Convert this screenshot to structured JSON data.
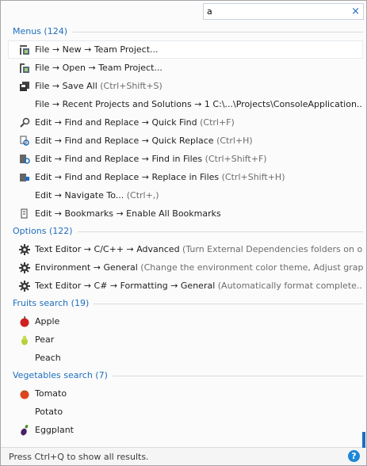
{
  "search": {
    "value": "a"
  },
  "clear_glyph": "×",
  "categories": [
    {
      "label": "Menus (124)",
      "rows": [
        {
          "text": "File → New → Team Project...",
          "hint": "",
          "icon": "new-team-project-icon"
        },
        {
          "text": "File → Open → Team Project...",
          "hint": "",
          "icon": "open-team-project-icon"
        },
        {
          "text": "File → Save All",
          "hint": " (Ctrl+Shift+S)",
          "icon": "save-all-icon"
        },
        {
          "text": "File → Recent Projects and Solutions → 1 C:\\...\\Projects\\ConsoleApplication...",
          "hint": "",
          "icon": ""
        },
        {
          "text": "Edit → Find and Replace → Quick Find",
          "hint": " (Ctrl+F)",
          "icon": "quick-find-icon"
        },
        {
          "text": "Edit → Find and Replace → Quick Replace",
          "hint": " (Ctrl+H)",
          "icon": "quick-replace-icon"
        },
        {
          "text": "Edit → Find and Replace → Find in Files",
          "hint": " (Ctrl+Shift+F)",
          "icon": "find-in-files-icon"
        },
        {
          "text": "Edit → Find and Replace → Replace in Files",
          "hint": " (Ctrl+Shift+H)",
          "icon": "replace-in-files-icon"
        },
        {
          "text": "Edit → Navigate To...",
          "hint": " (Ctrl+,)",
          "icon": ""
        },
        {
          "text": "Edit → Bookmarks → Enable All Bookmarks",
          "hint": "",
          "icon": "bookmarks-icon"
        }
      ]
    },
    {
      "label": "Options (122)",
      "rows": [
        {
          "text": "Text Editor → C/C++ → Advanced",
          "hint": " (Turn External Dependencies folders on o...",
          "icon": "gear-icon"
        },
        {
          "text": "Environment → General",
          "hint": " (Change the environment color theme, Adjust grap...",
          "icon": "gear-icon"
        },
        {
          "text": "Text Editor → C# → Formatting → General",
          "hint": " (Automatically format complete...",
          "icon": "gear-icon"
        }
      ]
    },
    {
      "label": "Fruits search (19)",
      "rows": [
        {
          "text": "Apple",
          "hint": "",
          "icon": "apple-icon"
        },
        {
          "text": "Pear",
          "hint": "",
          "icon": "pear-icon"
        },
        {
          "text": "Peach",
          "hint": "",
          "icon": ""
        }
      ]
    },
    {
      "label": "Vegetables search (7)",
      "rows": [
        {
          "text": "Tomato",
          "hint": "",
          "icon": "tomato-icon"
        },
        {
          "text": "Potato",
          "hint": "",
          "icon": ""
        },
        {
          "text": "Eggplant",
          "hint": "",
          "icon": "eggplant-icon"
        }
      ]
    }
  ],
  "footer": {
    "text": "Press Ctrl+Q to show all results.",
    "help": "?"
  },
  "colors": {
    "accent": "#1e6fbf",
    "help": "#1d86d8"
  }
}
